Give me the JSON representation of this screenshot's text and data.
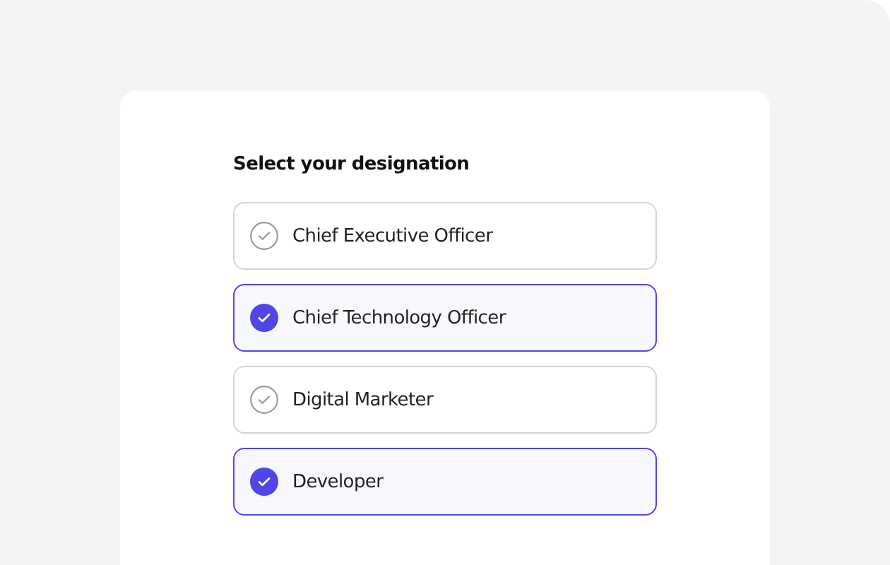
{
  "title": "Select your designation",
  "options": [
    {
      "label": "Chief Executive Officer",
      "selected": false
    },
    {
      "label": "Chief Technology Officer",
      "selected": true
    },
    {
      "label": "Digital Marketer",
      "selected": false
    },
    {
      "label": "Developer",
      "selected": true
    }
  ]
}
